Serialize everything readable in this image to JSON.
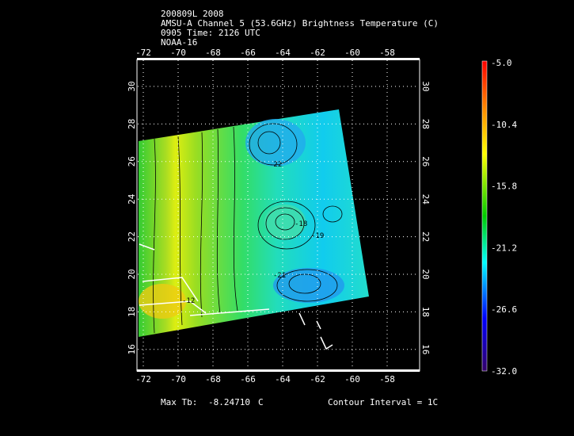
{
  "header": {
    "line1": "200809L 2008",
    "line2": "AMSU-A Channel 5 (53.6GHz) Brightness Temperature (C)",
    "line3": "0905 Time: 2126 UTC",
    "line4": "NOAA-16"
  },
  "map": {
    "lon_ticks": [
      "-72",
      "-70",
      "-68",
      "-66",
      "-64",
      "-62",
      "-60",
      "-58"
    ],
    "lon_values": [
      -72,
      -70,
      -68,
      -66,
      -64,
      -62,
      -60,
      -58
    ],
    "lat_ticks": [
      "30",
      "28",
      "26",
      "24",
      "22",
      "20",
      "18",
      "16"
    ],
    "lat_values": [
      30,
      28,
      26,
      24,
      22,
      20,
      18,
      16
    ],
    "contour_labels": [
      "-22",
      "-18",
      "-19",
      "-21",
      "-12"
    ]
  },
  "colorbar": {
    "labels": [
      "-5.0",
      "-10.4",
      "-15.8",
      "-21.2",
      "-26.6",
      "-32.0"
    ],
    "colors": [
      "#ff0000",
      "#ff9900",
      "#ffff00",
      "#00cc00",
      "#00ffff",
      "#0000ff",
      "#330066"
    ]
  },
  "footer": {
    "max_label": "Max Tb:",
    "max_value": "-8.24710",
    "max_unit": "C",
    "contour_interval": "Contour Interval = 1C"
  }
}
